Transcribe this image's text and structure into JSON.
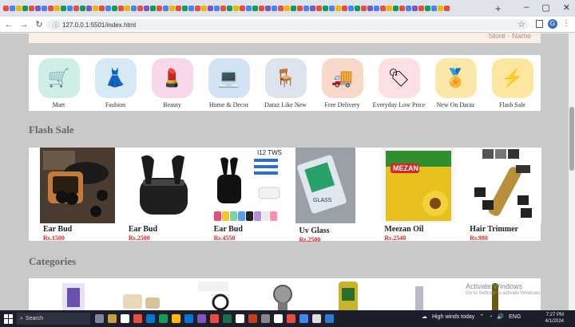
{
  "browser": {
    "tab_favicon_colors": [
      "#e94e3c",
      "#4285f4",
      "#f4b400",
      "#0f9d58",
      "#e94e3c",
      "#7e57c2",
      "#4285f4",
      "#e94e3c",
      "#f4b400",
      "#0f9d58",
      "#4285f4",
      "#e94e3c",
      "#0f9d58",
      "#7e57c2",
      "#f4b400",
      "#e94e3c",
      "#4285f4",
      "#0f9d58",
      "#e94e3c",
      "#f4b400",
      "#4285f4",
      "#e94e3c",
      "#7e57c2",
      "#0f9d58",
      "#e94e3c",
      "#4285f4",
      "#f4b400",
      "#e94e3c",
      "#0f9d58",
      "#4285f4",
      "#e94e3c",
      "#f4b400",
      "#7e57c2",
      "#4285f4",
      "#e94e3c",
      "#0f9d58",
      "#f4b400",
      "#e94e3c",
      "#4285f4",
      "#0f9d58",
      "#e94e3c",
      "#7e57c2",
      "#4285f4",
      "#e94e3c",
      "#f4b400",
      "#0f9d58",
      "#e94e3c",
      "#4285f4",
      "#7e57c2",
      "#e94e3c",
      "#0f9d58",
      "#4285f4",
      "#f4b400",
      "#e94e3c",
      "#4285f4",
      "#0f9d58",
      "#e94e3c",
      "#7e57c2",
      "#4285f4",
      "#e94e3c",
      "#f4b400",
      "#0f9d58",
      "#e94e3c",
      "#4285f4",
      "#7e57c2",
      "#e94e3c",
      "#0f9d58",
      "#4285f4",
      "#f4b400",
      "#e94e3c"
    ],
    "new_tab_label": "+",
    "url": "127.0.0.1:5501/index.html",
    "profile_initial": "G"
  },
  "page": {
    "top_strip_text": "Store · Name",
    "categories": [
      {
        "label": "Mart",
        "icon": "grocery-icon",
        "bg": "#cfeee8",
        "glyph": "🛒"
      },
      {
        "label": "Fashion",
        "icon": "fashion-icon",
        "bg": "#d6e9f5",
        "glyph": "👗"
      },
      {
        "label": "Beauty",
        "icon": "beauty-icon",
        "bg": "#f7d7e9",
        "glyph": "💄"
      },
      {
        "label": "Home & Decor",
        "icon": "laptop-icon",
        "bg": "#d3e3f3",
        "glyph": "💻"
      },
      {
        "label": "Daraz Like New",
        "icon": "chair-icon",
        "bg": "#dde4ee",
        "glyph": "🪑"
      },
      {
        "label": "Free Delivery",
        "icon": "truck-icon",
        "bg": "#f8d9c9",
        "glyph": "🚚"
      },
      {
        "label": "Everyday Low Price",
        "icon": "price-tag-icon",
        "bg": "#fde0e4",
        "glyph": "🏷"
      },
      {
        "label": "New On Daraz",
        "icon": "medal-icon",
        "bg": "#fbe7a8",
        "glyph": "🏅"
      },
      {
        "label": "Flash Sale",
        "icon": "lightning-icon",
        "bg": "#fde7a0",
        "glyph": "⚡"
      }
    ],
    "flash_sale_title": "Flash Sale",
    "products": [
      {
        "name": "Ear Bud",
        "price": "Rs.1500",
        "icon": "earbuds-case-icon"
      },
      {
        "name": "Ear Bud",
        "price": "Rs.2500",
        "icon": "airpods-pro-icon"
      },
      {
        "name": "Ear Bud",
        "price": "Rs.4550",
        "icon": "i12-tws-icon"
      },
      {
        "name": "Uv Glass",
        "price": "Rs.2500",
        "icon": "uv-glass-icon"
      },
      {
        "name": "Meezan Oil",
        "price": "Rs.2540",
        "icon": "cooking-oil-icon"
      },
      {
        "name": "Hair Trimmer",
        "price": "Rs.980",
        "icon": "trimmer-icon"
      }
    ],
    "categories_title": "Categories",
    "activate_line1": "Activate Windows",
    "activate_line2": "Go to Settings to activate Windows."
  },
  "taskbar": {
    "search_placeholder": "Search",
    "weather": "High winds today",
    "lang": "ENG",
    "time": "7:27 PM",
    "date": "4/1/2024"
  }
}
